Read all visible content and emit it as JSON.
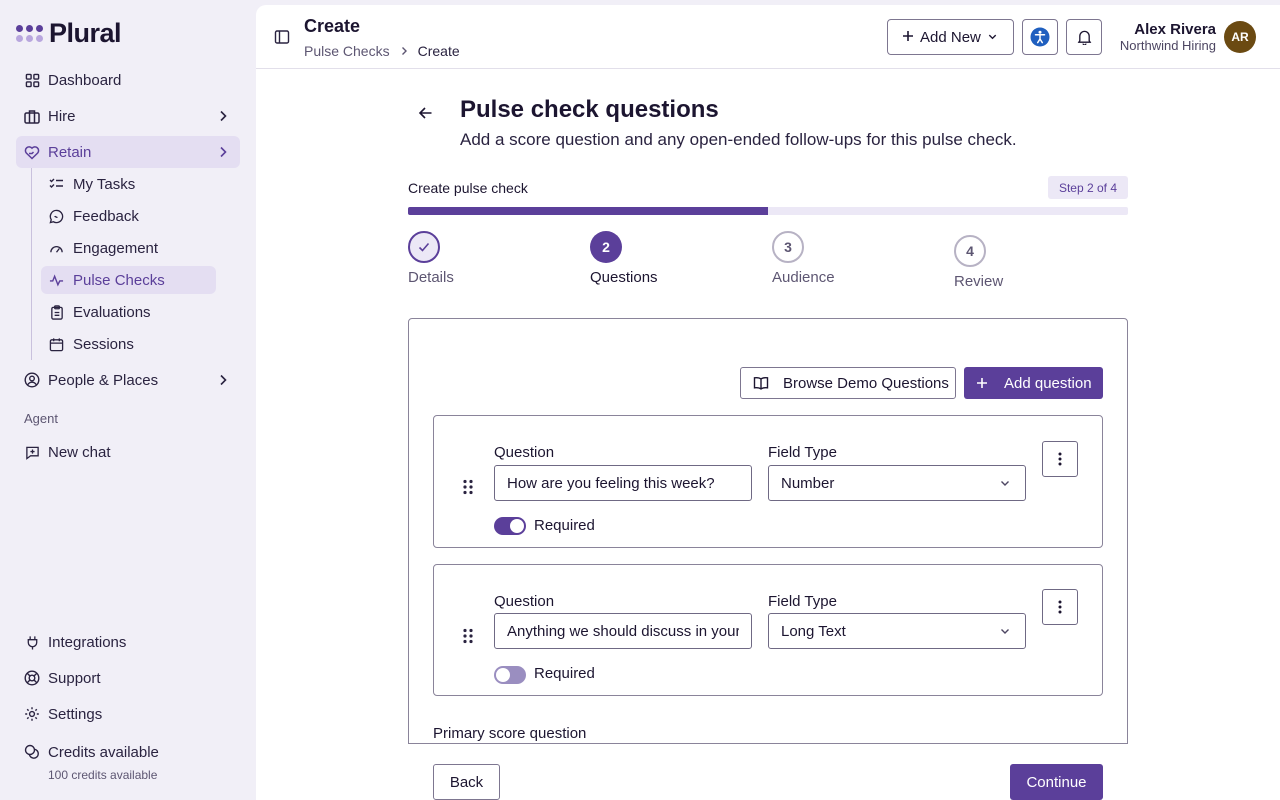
{
  "brand": {
    "name": "Plural",
    "accent": "#5b3f9a"
  },
  "sidebar": {
    "items": [
      {
        "label": "Dashboard",
        "icon": "grid-icon"
      },
      {
        "label": "Hire",
        "icon": "briefcase-icon"
      },
      {
        "label": "Retain",
        "icon": "heart-hand-icon"
      },
      {
        "label": "People & Places",
        "icon": "user-circle-icon"
      }
    ],
    "retain_sub": [
      {
        "label": "My Tasks",
        "icon": "checklist-icon"
      },
      {
        "label": "Feedback",
        "icon": "chat-bubble-icon"
      },
      {
        "label": "Engagement",
        "icon": "gauge-icon"
      },
      {
        "label": "Pulse Checks",
        "icon": "pulse-icon"
      },
      {
        "label": "Evaluations",
        "icon": "clipboard-icon"
      },
      {
        "label": "Sessions",
        "icon": "calendar-icon"
      }
    ],
    "agent_section": "Agent",
    "new_chat": "New chat",
    "bottom": [
      {
        "label": "Integrations",
        "icon": "plug-icon"
      },
      {
        "label": "Support",
        "icon": "lifebuoy-icon"
      },
      {
        "label": "Settings",
        "icon": "gear-icon"
      },
      {
        "label": "Credits available",
        "icon": "coins-icon"
      }
    ],
    "credits_detail": "100 credits available"
  },
  "header": {
    "title": "Create",
    "breadcrumb": [
      "Pulse Checks",
      "Create"
    ],
    "add_new": "Add New",
    "user": {
      "name": "Alex Rivera",
      "org": "Northwind Hiring",
      "initials": "AR"
    }
  },
  "page": {
    "title": "Pulse check questions",
    "subtitle": "Add a score question and any open-ended follow-ups for this pulse check."
  },
  "wizard": {
    "label": "Create pulse check",
    "badge": "Step 2 of 4",
    "progress_fraction": 0.5,
    "steps": [
      {
        "number": "1",
        "label": "Details",
        "state": "done"
      },
      {
        "number": "2",
        "label": "Questions",
        "state": "current"
      },
      {
        "number": "3",
        "label": "Audience",
        "state": "todo"
      },
      {
        "number": "4",
        "label": "Review",
        "state": "todo"
      }
    ]
  },
  "actions": {
    "browse": "Browse Demo Questions",
    "add_question": "Add question"
  },
  "questions": [
    {
      "question_label": "Question",
      "value": "How are you feeling this week?",
      "type_label": "Field Type",
      "type": "Number",
      "required_label": "Required",
      "required": true
    },
    {
      "question_label": "Question",
      "value": "Anything we should discuss in your",
      "type_label": "Field Type",
      "type": "Long Text",
      "required_label": "Required",
      "required": false
    }
  ],
  "primary_score_label": "Primary score question",
  "footer": {
    "back": "Back",
    "continue": "Continue"
  }
}
